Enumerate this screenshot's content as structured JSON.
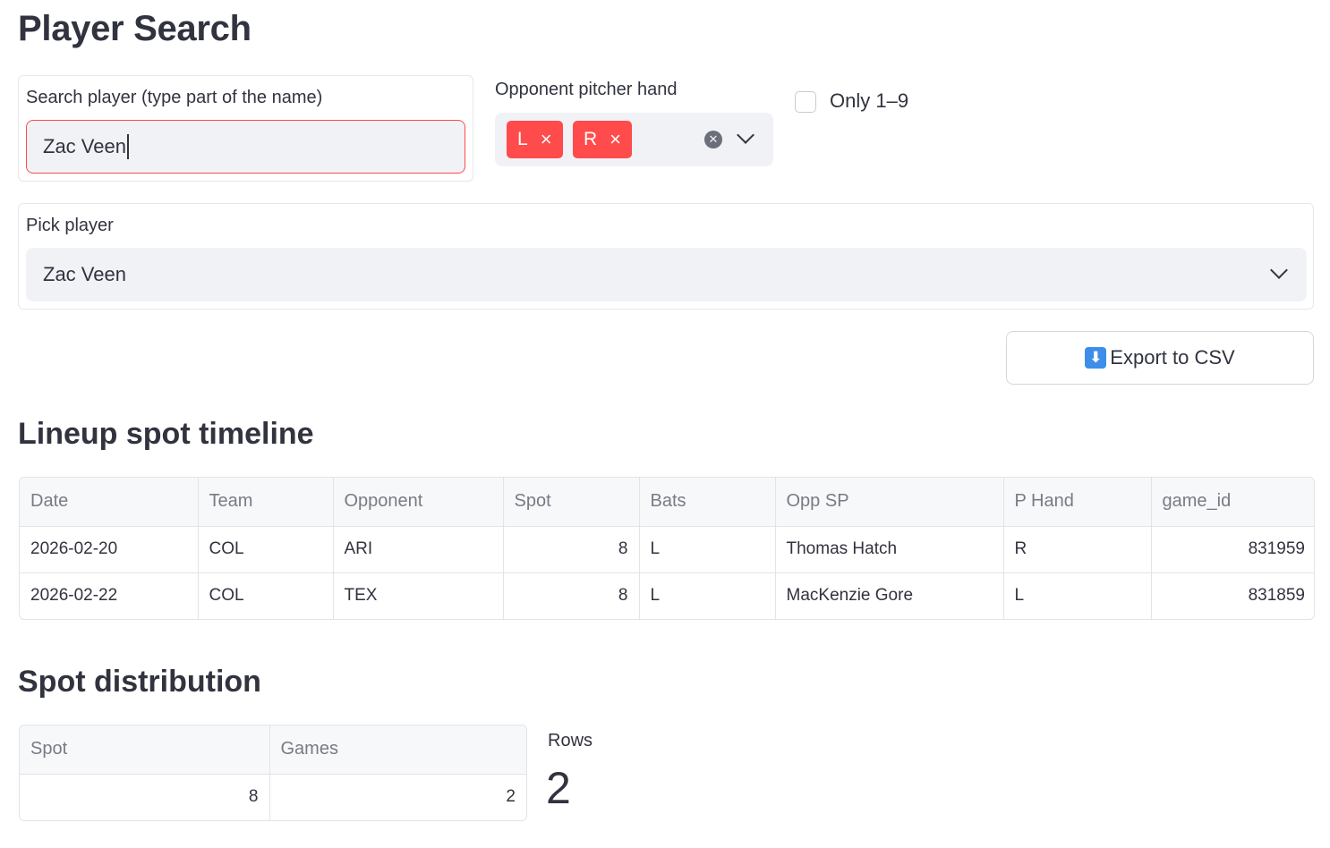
{
  "page_title": "Player Search",
  "search": {
    "label": "Search player (type part of the name)",
    "value": "Zac Veen"
  },
  "pitcher_hand": {
    "label": "Opponent pitcher hand",
    "selected": [
      "L",
      "R"
    ],
    "remove_glyph": "×"
  },
  "only_filter": {
    "label": "Only 1–9",
    "checked": false
  },
  "pick_player": {
    "label": "Pick player",
    "value": "Zac Veen"
  },
  "export": {
    "label": "Export to CSV",
    "icon": "download-arrow-icon",
    "icon_glyph": "⬇"
  },
  "timeline": {
    "title": "Lineup spot timeline",
    "columns": [
      "Date",
      "Team",
      "Opponent",
      "Spot",
      "Bats",
      "Opp SP",
      "P Hand",
      "game_id"
    ],
    "rows": [
      [
        "2026-02-20",
        "COL",
        "ARI",
        "8",
        "L",
        "Thomas Hatch",
        "R",
        "831959"
      ],
      [
        "2026-02-22",
        "COL",
        "TEX",
        "8",
        "L",
        "MacKenzie Gore",
        "L",
        "831859"
      ]
    ]
  },
  "distribution": {
    "title": "Spot distribution",
    "columns": [
      "Spot",
      "Games"
    ],
    "rows": [
      [
        "8",
        "2"
      ]
    ]
  },
  "rows_metric": {
    "label": "Rows",
    "value": "2"
  },
  "colors": {
    "accent": "#ff4b4b",
    "text": "#31333f",
    "input_bg": "#f0f2f6"
  }
}
